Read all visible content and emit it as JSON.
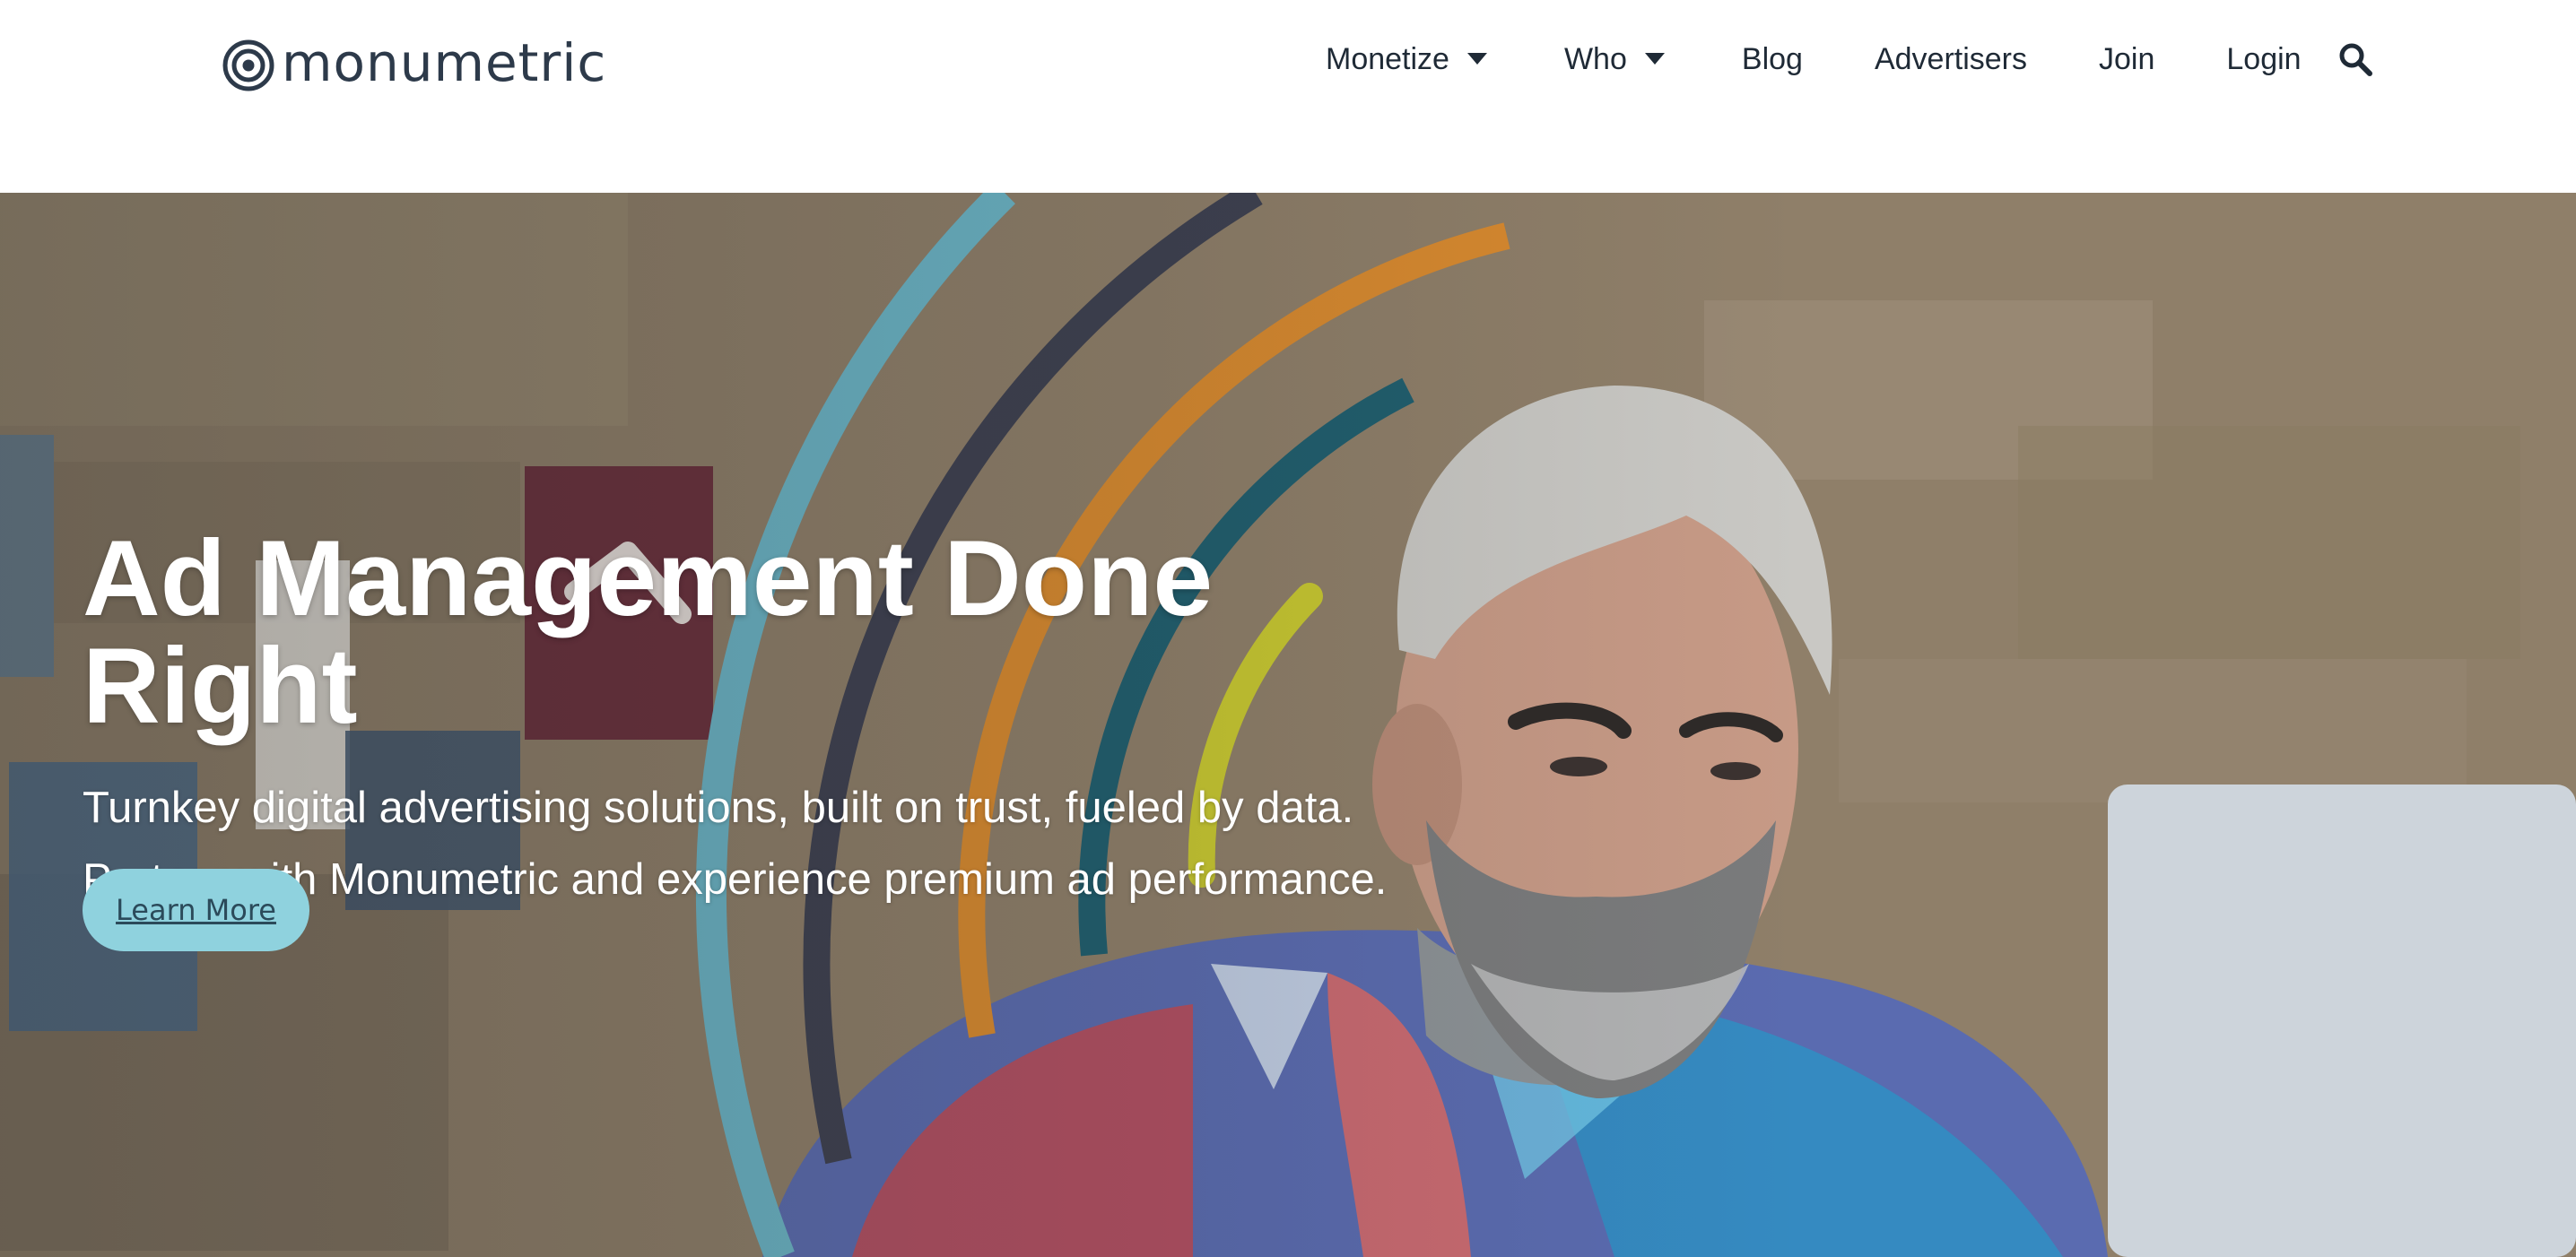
{
  "header": {
    "logo_text": "monumetric",
    "nav": {
      "monetize": "Monetize",
      "who": "Who",
      "blog": "Blog",
      "advertisers": "Advertisers",
      "join": "Join",
      "login": "Login"
    },
    "icons": [
      "logo-mark-icon",
      "caret-down-icon",
      "search-icon"
    ]
  },
  "hero": {
    "title": "Ad Management Done Right",
    "subtitle": "Turnkey digital advertising solutions, built on trust, fueled by data. Partner with Monumetric and experience premium ad performance.",
    "cta_label": "Learn More",
    "arc_colors": [
      "#6bb6c8",
      "#3d4050",
      "#d98a2e",
      "#1f5e6e",
      "#c9c930"
    ]
  }
}
